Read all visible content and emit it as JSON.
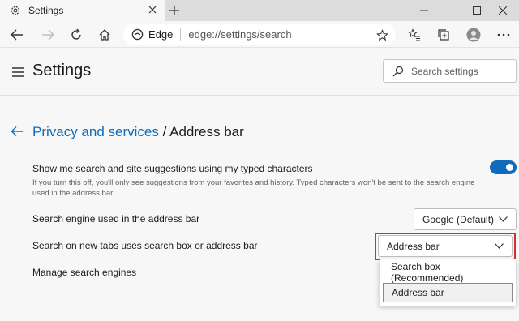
{
  "tab": {
    "title": "Settings"
  },
  "address_bar": {
    "site_label": "Edge",
    "url": "edge://settings/search"
  },
  "header": {
    "title": "Settings",
    "search_placeholder": "Search settings"
  },
  "breadcrumb": {
    "parent": "Privacy and services",
    "separator": " / ",
    "current": "Address bar"
  },
  "settings": {
    "suggestions": {
      "title": "Show me search and site suggestions using my typed characters",
      "description": "If you turn this off, you'll only see suggestions from your favorites and history. Typed characters won't be sent to the search engine used in the address bar.",
      "enabled": true
    },
    "search_engine": {
      "title": "Search engine used in the address bar",
      "value": "Google (Default)"
    },
    "new_tabs": {
      "title": "Search on new tabs uses search box or address bar",
      "value": "Address bar",
      "options": [
        "Search box (Recommended)",
        "Address bar"
      ]
    },
    "manage": {
      "title": "Manage search engines"
    }
  },
  "colors": {
    "accent": "#0f6cbd",
    "highlight": "#d32f2f",
    "background": "#f7f7f7"
  },
  "icons": [
    "gear-icon",
    "close-icon",
    "plus-icon",
    "minimize-icon",
    "maximize-icon",
    "back-icon",
    "forward-icon",
    "refresh-icon",
    "home-icon",
    "edge-logo-icon",
    "star-icon",
    "favorites-icon",
    "collections-icon",
    "profile-icon",
    "more-icon",
    "menu-icon",
    "search-icon",
    "chevron-down-icon"
  ]
}
